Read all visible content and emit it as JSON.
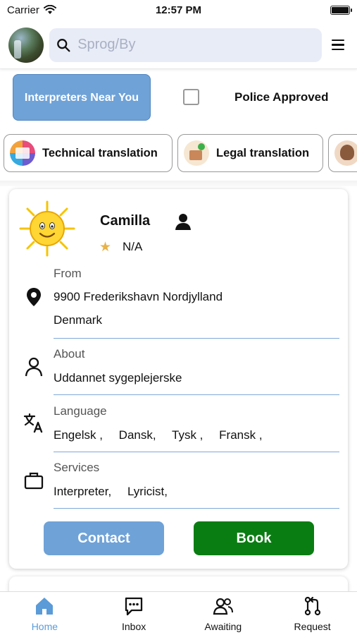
{
  "status_bar": {
    "carrier": "Carrier",
    "time": "12:57 PM"
  },
  "header": {
    "search_placeholder": "Sprog/By",
    "avatar_icon": "avatar-photo",
    "menu_icon": "hamburger-menu-icon"
  },
  "filters": {
    "near_button": "Interpreters Near You",
    "police_approved_label": "Police Approved",
    "police_approved_checked": false
  },
  "categories": [
    {
      "label": "Technical translation",
      "icon": "technical-translation-icon"
    },
    {
      "label": "Legal translation",
      "icon": "legal-translation-icon"
    },
    {
      "label": "",
      "icon": "person-icon"
    }
  ],
  "profile": {
    "name": "Camilla",
    "rating": "N/A",
    "from_label": "From",
    "from_line1": "9900 Frederikshavn  Nordjylland",
    "from_line2": "Denmark",
    "about_label": "About",
    "about_value": "Uddannet sygeplejerske",
    "language_label": "Language",
    "languages": [
      "Engelsk ,",
      "Dansk,",
      "Tysk ,",
      "Fransk ,"
    ],
    "services_label": "Services",
    "services": [
      "Interpreter,",
      "Lyricist,"
    ],
    "contact_label": "Contact",
    "book_label": "Book"
  },
  "tabbar": {
    "tabs": [
      {
        "label": "Home",
        "active": true
      },
      {
        "label": "Inbox",
        "active": false
      },
      {
        "label": "Awaiting",
        "active": false
      },
      {
        "label": "Request",
        "active": false
      }
    ]
  },
  "colors": {
    "accent_blue": "#6fa2d7",
    "book_green": "#0a7d12",
    "active_tab": "#5a9bd8",
    "section_line": "#7fa8d8"
  }
}
